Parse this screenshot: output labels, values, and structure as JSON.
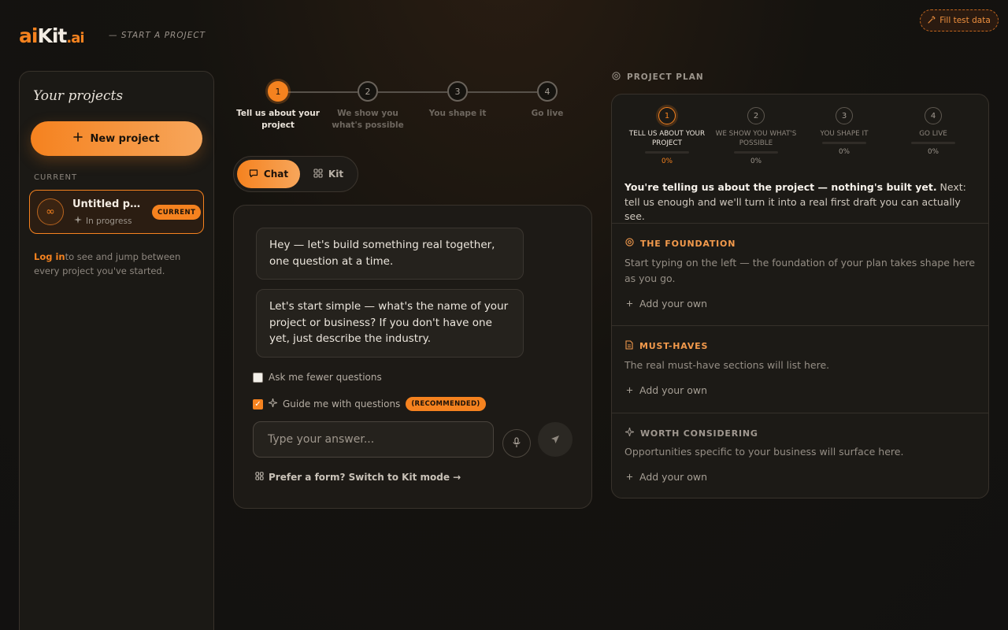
{
  "header": {
    "logo_ai": "ai",
    "logo_kit": "Kit",
    "logo_dot": ".ai",
    "tagline": "— START A PROJECT",
    "fill_test_label": "Fill test data"
  },
  "sidebar": {
    "title": "Your projects",
    "new_project_label": "New project",
    "current_section_label": "CURRENT",
    "project": {
      "name": "Untitled project",
      "status": "In progress",
      "badge": "CURRENT"
    },
    "login_link": "Log in",
    "login_text": "to see and jump between every project you've started."
  },
  "stepper": {
    "steps": [
      {
        "number": "1",
        "label": "Tell us about your project"
      },
      {
        "number": "2",
        "label": "We show you what's possible"
      },
      {
        "number": "3",
        "label": "You shape it"
      },
      {
        "number": "4",
        "label": "Go live"
      }
    ],
    "active_step": 1
  },
  "modes": {
    "chat_label": "Chat",
    "kit_label": "Kit",
    "active": "Chat"
  },
  "chat": {
    "messages": [
      "Hey — let's build something real together, one question at a time.",
      "Let's start simple — what's the name of your project or business? If you don't have one yet, just describe the industry."
    ],
    "fewer_questions_label": "Ask me fewer questions",
    "fewer_questions_checked": false,
    "guide_label": "Guide me with questions",
    "guide_checked": true,
    "recommended_badge": "(RECOMMENDED)",
    "answer_placeholder": "Type your answer...",
    "switch_link": "Prefer a form? Switch to Kit mode →"
  },
  "plan": {
    "heading": "PROJECT PLAN",
    "steps": [
      {
        "number": "1",
        "label": "TELL US ABOUT YOUR PROJECT",
        "percent": "0%"
      },
      {
        "number": "2",
        "label": "WE SHOW YOU WHAT'S POSSIBLE",
        "percent": "0%"
      },
      {
        "number": "3",
        "label": "YOU SHAPE IT",
        "percent": "0%"
      },
      {
        "number": "4",
        "label": "GO LIVE",
        "percent": "0%"
      }
    ],
    "summary_bold": "You're telling us about the project — nothing's built yet.",
    "summary_rest": " Next: tell us enough and we'll turn it into a real first draft you can actually see.",
    "sections": [
      {
        "title": "THE FOUNDATION",
        "icon": "target-icon",
        "description": "Start typing on the left — the foundation of your plan takes shape here as you go.",
        "add_label": "Add your own"
      },
      {
        "title": "MUST-HAVES",
        "icon": "document-icon",
        "description": "The real must-have sections will list here.",
        "add_label": "Add your own"
      },
      {
        "title": "WORTH CONSIDERING",
        "icon": "sparkle-icon",
        "description": "Opportunities specific to your business will surface here.",
        "add_label": "Add your own"
      }
    ]
  },
  "colors": {
    "accent": "#f5821f",
    "background": "#15130f",
    "panel": "#1c1a16"
  }
}
